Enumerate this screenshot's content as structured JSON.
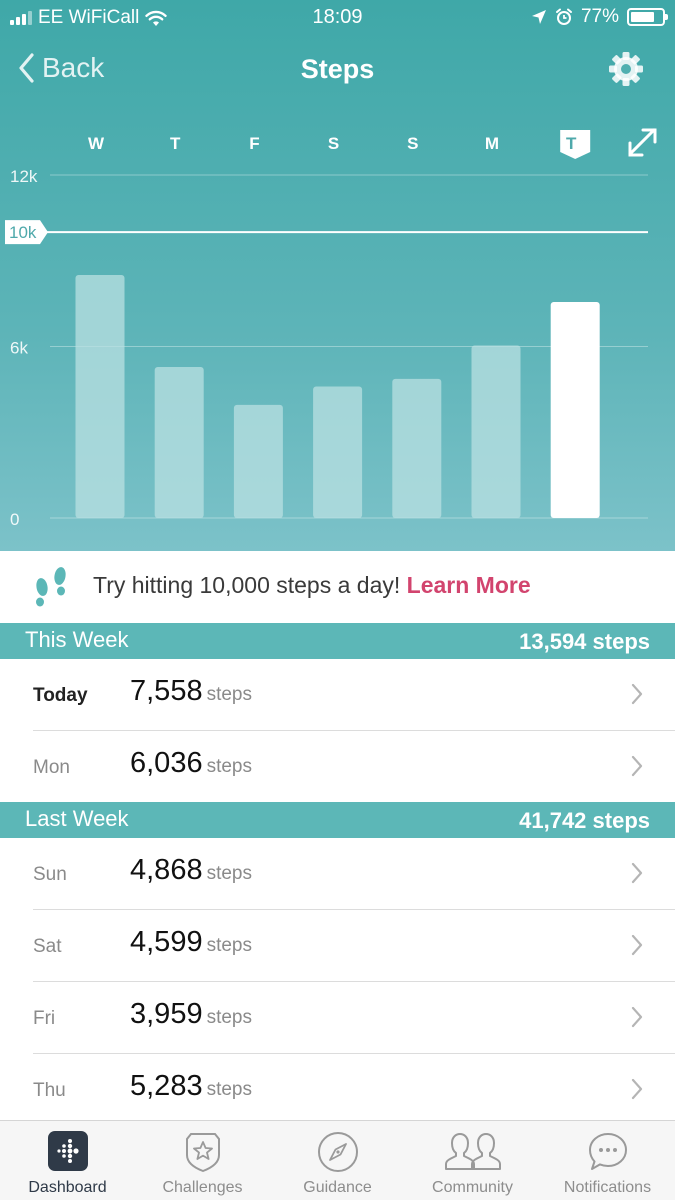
{
  "status_bar": {
    "carrier": "EE WiFiCall",
    "time": "18:09",
    "battery": "77%",
    "battery_level": 0.77
  },
  "nav": {
    "back_label": "Back",
    "title": "Steps"
  },
  "chart_data": {
    "type": "bar",
    "categories": [
      "W",
      "T",
      "F",
      "S",
      "S",
      "M",
      "T"
    ],
    "values": [
      8500,
      5283,
      3959,
      4599,
      4868,
      6036,
      7558
    ],
    "y_tick_labels": [
      "12k",
      "6k",
      "0"
    ],
    "goal_label": "10k",
    "goal_value": 10000,
    "ylim": [
      0,
      12000
    ],
    "highlight_index": 6,
    "colors": {
      "bar": "#b9e0e1",
      "bar_highlight": "#ffffff"
    }
  },
  "tip": {
    "text": "Try hitting 10,000 steps a day!",
    "link": "Learn More"
  },
  "this_week": {
    "title": "This Week",
    "total": "13,594 steps",
    "rows": [
      {
        "day": "Today",
        "value": "7,558",
        "unit": "steps"
      },
      {
        "day": "Mon",
        "value": "6,036",
        "unit": "steps"
      }
    ]
  },
  "last_week": {
    "title": "Last Week",
    "total": "41,742 steps",
    "rows": [
      {
        "day": "Sun",
        "value": "4,868",
        "unit": "steps"
      },
      {
        "day": "Sat",
        "value": "4,599",
        "unit": "steps"
      },
      {
        "day": "Fri",
        "value": "3,959",
        "unit": "steps"
      },
      {
        "day": "Thu",
        "value": "5,283",
        "unit": "steps"
      }
    ]
  },
  "tabs": [
    {
      "label": "Dashboard",
      "icon": "dashboard-icon",
      "active": true
    },
    {
      "label": "Challenges",
      "icon": "challenges-icon",
      "active": false
    },
    {
      "label": "Guidance",
      "icon": "compass-icon",
      "active": false
    },
    {
      "label": "Community",
      "icon": "community-icon",
      "active": false
    },
    {
      "label": "Notifications",
      "icon": "chat-bubble-icon",
      "active": false
    }
  ],
  "colors": {
    "teal_header": "#5cb7b7",
    "link": "#d2446e"
  }
}
